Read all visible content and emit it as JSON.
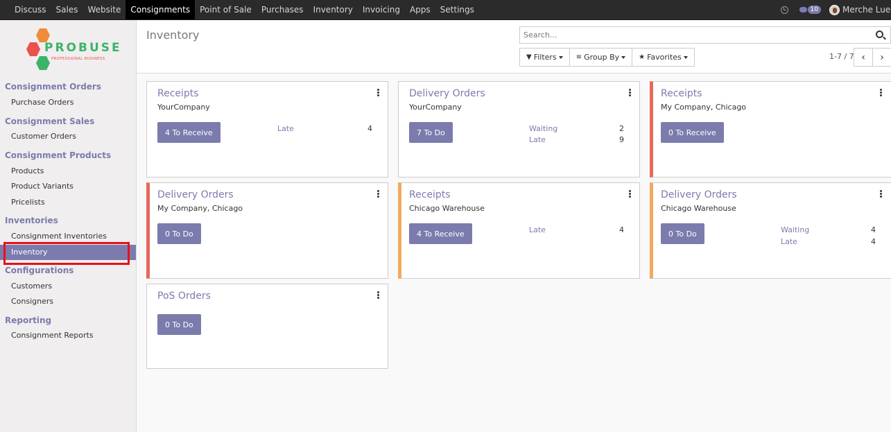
{
  "topbar": {
    "menu": [
      "Discuss",
      "Sales",
      "Website",
      "Consignments",
      "Point of Sale",
      "Purchases",
      "Inventory",
      "Invoicing",
      "Apps",
      "Settings"
    ],
    "active_index": 3,
    "message_count": "10",
    "user_name": "Merche Lueng"
  },
  "logo": {
    "brand": "PROBUSE",
    "tagline": "PROFESSIONAL BUSINESS"
  },
  "sidebar": {
    "sections": [
      {
        "title": "Consignment Orders",
        "items": [
          "Purchase Orders"
        ]
      },
      {
        "title": "Consignment Sales",
        "items": [
          "Customer Orders"
        ]
      },
      {
        "title": "Consignment Products",
        "items": [
          "Products",
          "Product Variants",
          "Pricelists"
        ]
      },
      {
        "title": "Inventories",
        "items": [
          "Consignment Inventories",
          "Inventory"
        ]
      },
      {
        "title": "Configurations",
        "items": [
          "Customers",
          "Consigners"
        ]
      },
      {
        "title": "Reporting",
        "items": [
          "Consignment Reports"
        ]
      }
    ],
    "active_item": "Inventory"
  },
  "control_panel": {
    "breadcrumb": "Inventory",
    "search_placeholder": "Search...",
    "filters_label": "Filters",
    "group_by_label": "Group By",
    "favorites_label": "Favorites",
    "pager": "1-7 / 7"
  },
  "cards": [
    {
      "title": "Receipts",
      "subtitle": "YourCompany",
      "action": "4 To Receive",
      "stats": [
        {
          "label": "Late",
          "value": "4"
        }
      ],
      "bar": "none"
    },
    {
      "title": "Delivery Orders",
      "subtitle": "YourCompany",
      "action": "7 To Do",
      "stats": [
        {
          "label": "Waiting",
          "value": "2"
        },
        {
          "label": "Late",
          "value": "9"
        }
      ],
      "bar": "none"
    },
    {
      "title": "Receipts",
      "subtitle": "My Company, Chicago",
      "action": "0 To Receive",
      "stats": [],
      "bar": "red"
    },
    {
      "title": "Delivery Orders",
      "subtitle": "My Company, Chicago",
      "action": "0 To Do",
      "stats": [],
      "bar": "red"
    },
    {
      "title": "Receipts",
      "subtitle": "Chicago Warehouse",
      "action": "4 To Receive",
      "stats": [
        {
          "label": "Late",
          "value": "4"
        }
      ],
      "bar": "orange"
    },
    {
      "title": "Delivery Orders",
      "subtitle": "Chicago Warehouse",
      "action": "0 To Do",
      "stats": [
        {
          "label": "Waiting",
          "value": "4"
        },
        {
          "label": "Late",
          "value": "4"
        }
      ],
      "bar": "orange"
    },
    {
      "title": "PoS Orders",
      "subtitle": "",
      "action": "0 To Do",
      "stats": [],
      "bar": "none"
    }
  ],
  "colors": {
    "accent": "#7c7bad",
    "topbar": "#2b2b2b",
    "bar_red": "#e9675c",
    "bar_orange": "#f4a85f",
    "highlight": "#e8101a"
  }
}
